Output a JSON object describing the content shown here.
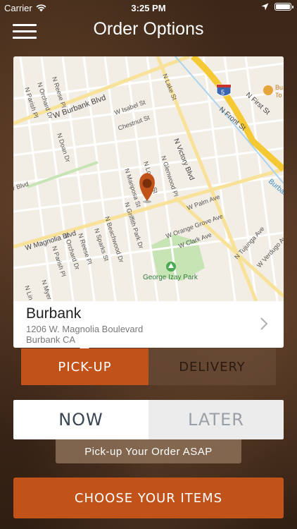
{
  "status_bar": {
    "carrier": "Carrier",
    "time": "3:25 PM",
    "battery_level": 1.0
  },
  "nav": {
    "title": "Order Options",
    "menu_icon": "hamburger-icon"
  },
  "map": {
    "labels": {
      "burbank_blvd": "W Burbank Blvd",
      "isabel": "W Isabel St",
      "chestnut": "Chestnut St",
      "lake": "N Lake St",
      "doan": "N Doan Dr",
      "victory": "N Victory Blvd",
      "front": "N Front St",
      "first": "N First St",
      "glenwood": "N Glenwood Pl",
      "lomita": "N Lomita St",
      "mariposa": "N Mariposa St",
      "griffith": "N Griffith Park Dr",
      "beachwood": "N Beachwood Dr",
      "sparks": "N Sparks St",
      "reese": "N Reese Pl",
      "orchard": "N Orchard Dr",
      "parish": "N Parish Pl",
      "palm": "W Palm Ave",
      "orange_grove": "W Orange Grove Ave",
      "clark": "W Clark Ave",
      "tujunga": "N Tujunga Ave",
      "verdugo": "W Verdugo Ave",
      "magnolia": "W Magnolia Blvd",
      "park": "George Izay Park",
      "blvd_left": "r Blvd",
      "interstate": "5",
      "top_parish": "N Parish Pl",
      "top_orchard": "N Orchard Dr",
      "top_reese": "N Reese Pl",
      "burbank_partial": "Burban",
      "bu_partial": "Bu",
      "to_partial": "To",
      "myer_partial": "N Myer",
      "lin_partial": "N Lin"
    }
  },
  "location": {
    "name": "Burbank",
    "address_line1": "1206 W. Magnolia Boulevard",
    "address_line2": "Burbank CA"
  },
  "order_type": {
    "pickup_label": "PICK-UP",
    "delivery_label": "DELIVERY",
    "selected": "PICK-UP"
  },
  "timing": {
    "now_label": "NOW",
    "later_label": "LATER",
    "selected": "NOW",
    "description": "Pick-up Your Order ASAP"
  },
  "cta": {
    "label": "CHOOSE YOUR ITEMS"
  },
  "colors": {
    "accent": "#c1531a",
    "now_text": "#3b4654"
  }
}
